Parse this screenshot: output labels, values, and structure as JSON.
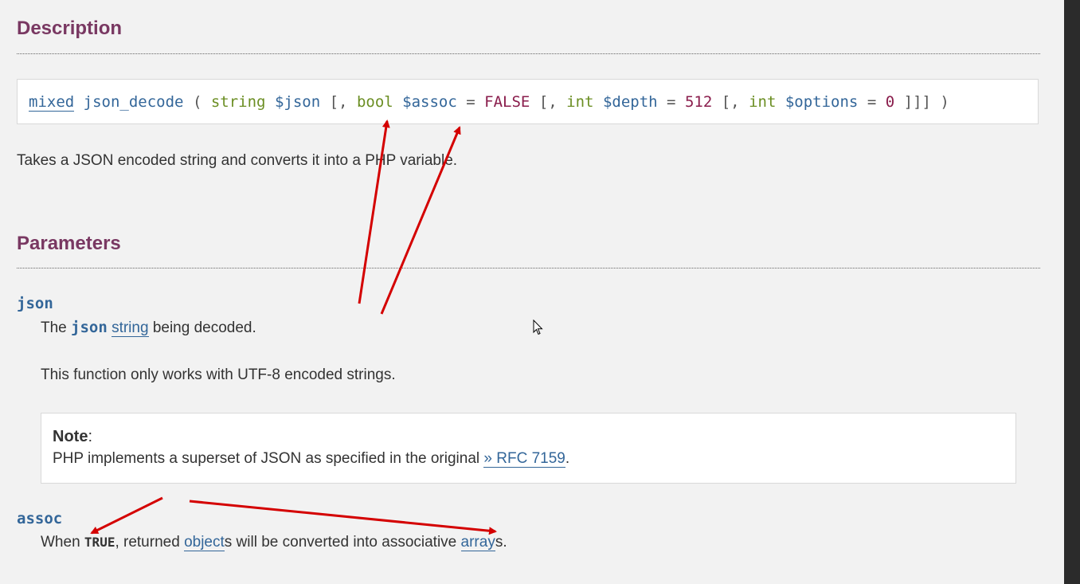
{
  "description": {
    "title": "Description",
    "signature": {
      "return_type": "mixed",
      "function_name": "json_decode",
      "open_paren": "(",
      "p1_type": "string",
      "p1_var": "$json",
      "opt1": "[,",
      "p2_type": "bool",
      "p2_var": "$assoc",
      "eq1": "=",
      "p2_default": "FALSE",
      "opt2": "[,",
      "p3_type": "int",
      "p3_var": "$depth",
      "eq2": "=",
      "p3_default": "512",
      "opt3": "[,",
      "p4_type": "int",
      "p4_var": "$options",
      "eq3": "=",
      "p4_default": "0",
      "close": "]]] )"
    },
    "intro": "Takes a JSON encoded string and converts it into a PHP variable."
  },
  "parameters": {
    "title": "Parameters",
    "json": {
      "name": "json",
      "desc_prefix": "The",
      "desc_param": "json",
      "desc_link": "string",
      "desc_suffix": "being decoded.",
      "desc2": "This function only works with UTF-8 encoded strings.",
      "note": {
        "title": "Note",
        "colon": ":",
        "body_prefix": "PHP implements a superset of JSON as specified in the original",
        "link": "» RFC 7159",
        "body_suffix": "."
      }
    },
    "assoc": {
      "name": "assoc",
      "desc_prefix": "When",
      "desc_const": "TRUE",
      "desc_mid": ", returned",
      "desc_link1": "object",
      "desc_mid2": "s will be converted into associative",
      "desc_link2": "array",
      "desc_suffix": "s."
    }
  },
  "colors": {
    "heading": "#793862",
    "link": "#336699",
    "type": "#6b8e23",
    "value": "#8a1d4c",
    "annotation_arrow": "#d40000",
    "background": "#f2f2f2"
  },
  "icons": [
    "mouse-pointer-icon"
  ]
}
